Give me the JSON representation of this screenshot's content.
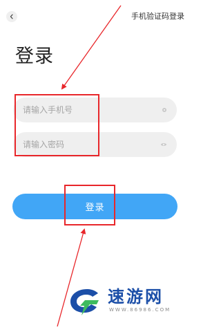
{
  "header": {
    "back_icon": "chevron-left-icon",
    "sms_login_link": "手机验证码登录"
  },
  "page": {
    "title": "登录"
  },
  "form": {
    "phone_placeholder": "请输入手机号",
    "phone_value": "",
    "phone_icon": "clear-dot-icon",
    "password_placeholder": "请输入密码",
    "password_value": "",
    "password_icon": "eye-icon"
  },
  "actions": {
    "login_label": "登录"
  },
  "watermark": {
    "name": "速游网",
    "url": "WWW.86986.COM"
  },
  "colors": {
    "primary": "#41a6f6",
    "field_bg": "#efefef",
    "annotation": "#e8262a",
    "watermark_blue": "#1c4fa8"
  }
}
